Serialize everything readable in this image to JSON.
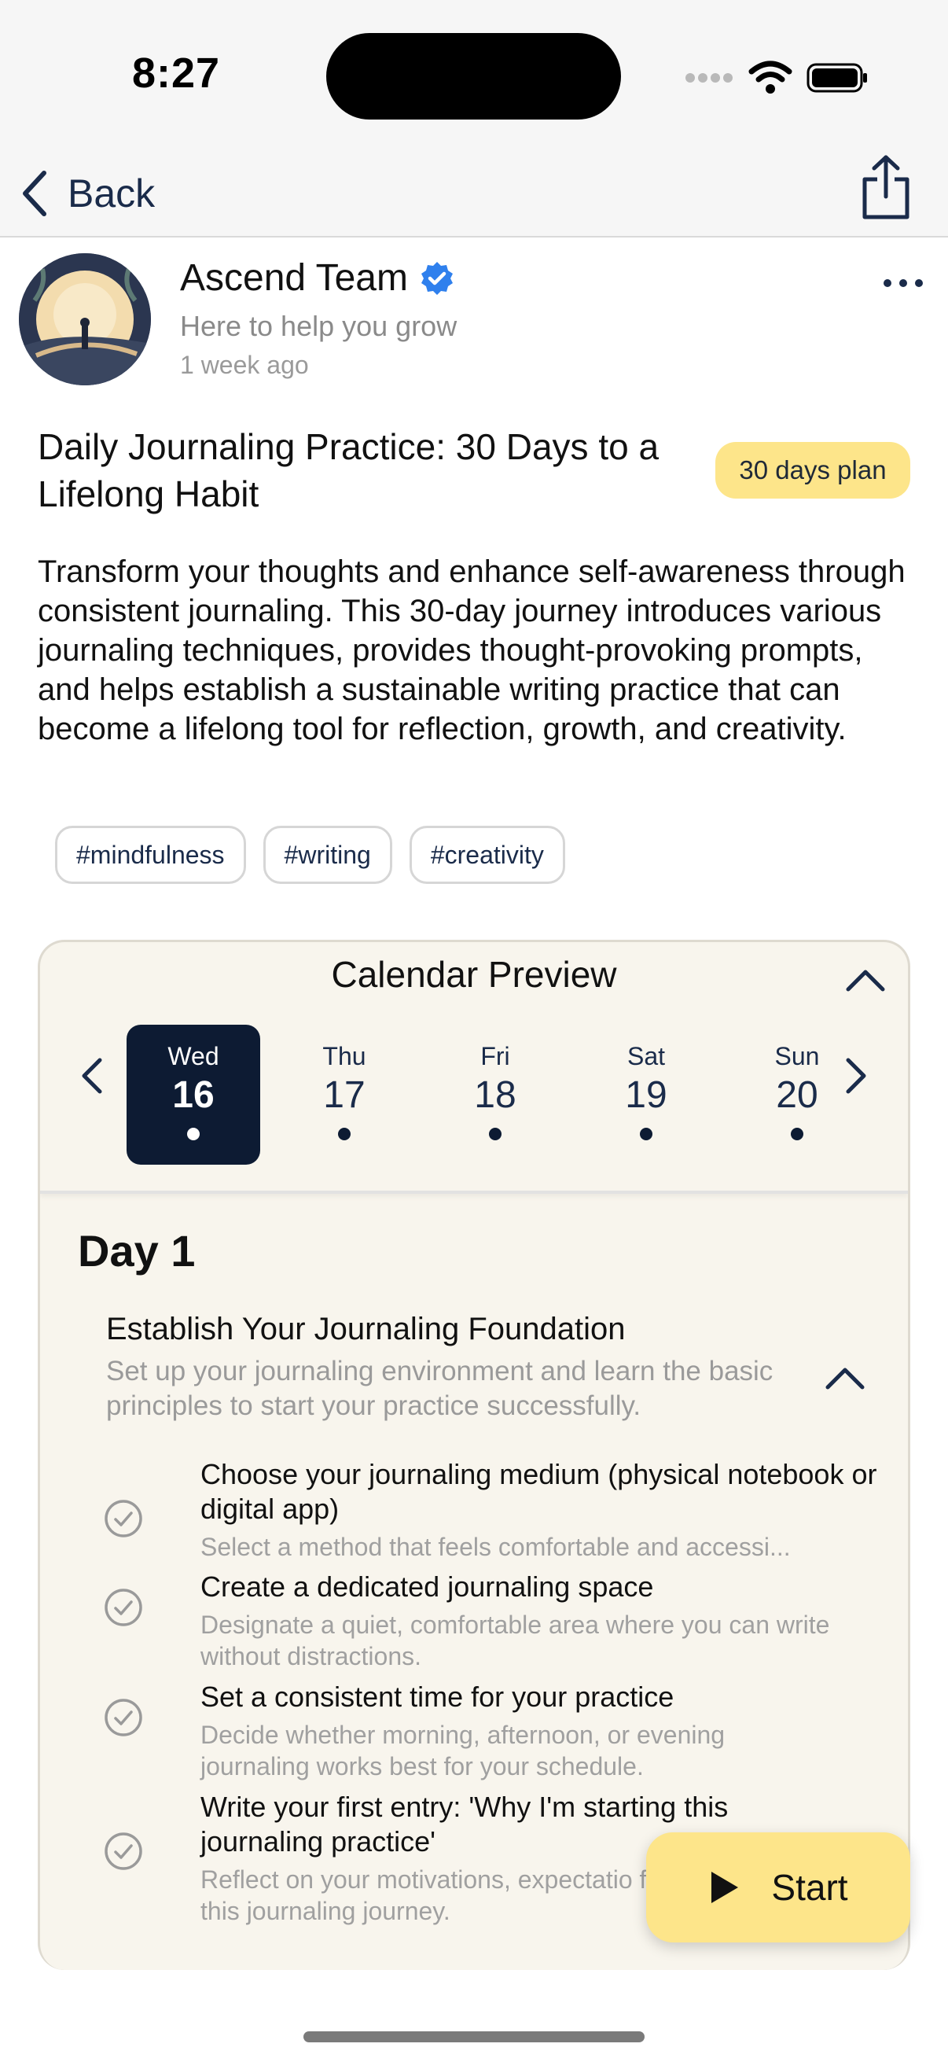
{
  "status_bar": {
    "time": "8:27"
  },
  "nav": {
    "back_label": "Back"
  },
  "author": {
    "name": "Ascend Team",
    "tagline": "Here to help you grow",
    "posted": "1 week ago"
  },
  "plan": {
    "title": "Daily Journaling Practice: 30 Days to a Lifelong Habit",
    "badge": "30 days plan",
    "description": "Transform your thoughts and enhance self-awareness through consistent journaling. This 30-day journey introduces various journaling techniques, provides thought-provoking prompts, and helps establish a sustainable writing practice that can become a lifelong tool for reflection, growth, and creativity.",
    "tags": [
      "#mindfulness",
      "#writing",
      "#creativity"
    ]
  },
  "calendar": {
    "title": "Calendar Preview",
    "days": [
      {
        "dow": "Wed",
        "num": "16"
      },
      {
        "dow": "Thu",
        "num": "17"
      },
      {
        "dow": "Fri",
        "num": "18"
      },
      {
        "dow": "Sat",
        "num": "19"
      },
      {
        "dow": "Sun",
        "num": "20"
      }
    ]
  },
  "day": {
    "heading": "Day 1",
    "section_title": "Establish Your Journaling Foundation",
    "section_desc": "Set up your journaling environment and learn the basic principles to start your practice successfully.",
    "tasks": [
      {
        "title": "Choose your journaling medium (physical notebook or digital app)",
        "desc": "Select a method that feels comfortable and accessi..."
      },
      {
        "title": "Create a dedicated journaling space",
        "desc": "Designate a quiet, comfortable area where you can write without distractions."
      },
      {
        "title": "Set a consistent time for your practice",
        "desc": "Decide whether morning, afternoon, or evening journaling works best for your schedule."
      },
      {
        "title": "Write your first entry: 'Why I'm starting this journaling practice'",
        "desc": "Reflect on your motivations, expectatio for this journaling journey."
      }
    ]
  },
  "start_button": {
    "label": "Start"
  },
  "colors": {
    "accent_yellow": "#fde58a",
    "navy": "#0d1b33",
    "verified_blue": "#2f80ed"
  },
  "icons": [
    "back-chevron-icon",
    "share-icon",
    "verified-badge-icon",
    "more-icon",
    "chevron-up-icon",
    "chevron-left-icon",
    "chevron-right-icon",
    "check-circle-icon",
    "play-icon"
  ]
}
